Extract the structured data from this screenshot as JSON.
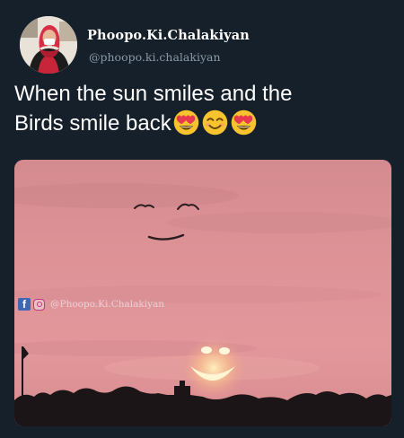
{
  "account": {
    "display_name": "Phoopo.Ki.Chalakiyan",
    "username": "@phoopo.ki.chalakiyan"
  },
  "tweet": {
    "text_line1": "When the sun smiles and the",
    "text_line2": "Birds smile back",
    "emojis": [
      "heart-eyes-emoji",
      "smiling-face-emoji",
      "heart-eyes-emoji"
    ]
  },
  "photo": {
    "watermark_text": "@Phoopo.Ki.Chalakiyan",
    "watermark_icons": [
      "facebook-icon",
      "instagram-icon"
    ]
  },
  "colors": {
    "background": "#15202b",
    "text_primary": "#ffffff",
    "text_secondary": "#8899a6",
    "sky_top": "#d98a8e",
    "sky_bottom": "#e5969a"
  }
}
